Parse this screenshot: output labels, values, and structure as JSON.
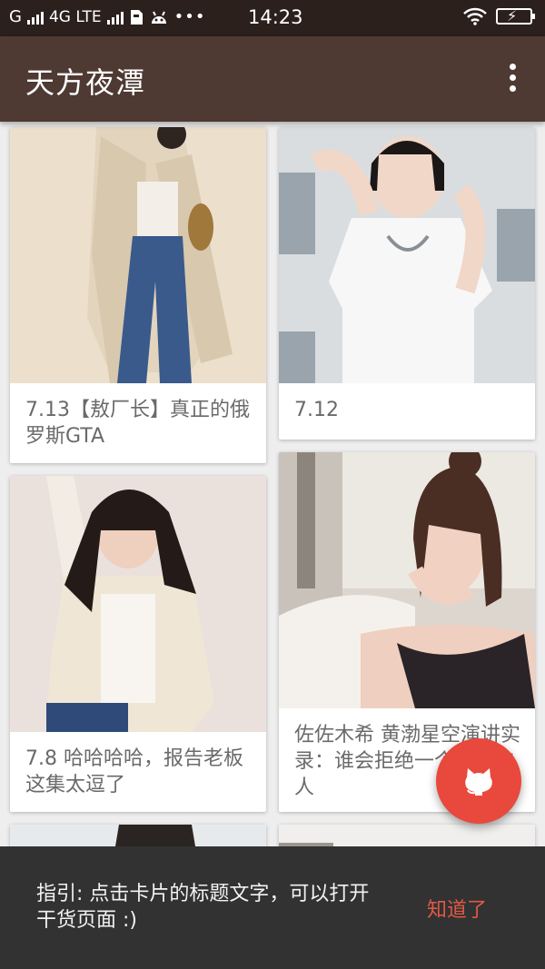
{
  "status_bar": {
    "carrier_left": "G",
    "network": "4G LTE",
    "time": "14:23"
  },
  "app_bar": {
    "title": "天方夜潭",
    "menu_icon": "more-vert-icon"
  },
  "cards": [
    {
      "caption": "7.13【敖厂长】真正的俄罗斯GTA",
      "image": "photo-woman-trench-coat"
    },
    {
      "caption": "7.12",
      "image": "photo-woman-white-blouse"
    },
    {
      "caption": "7.8 哈哈哈哈，报告老板这集太逗了",
      "image": "photo-woman-long-hair-jacket"
    },
    {
      "caption": "佐佐木希 黄渤星空演讲实录：谁会拒绝一个幽默的人",
      "image": "photo-woman-window-pose"
    }
  ],
  "fab": {
    "icon": "github-octocat-icon"
  },
  "snackbar": {
    "message": "指引: 点击卡片的标题文字，可以打开干货页面 :)",
    "action": "知道了",
    "action_color": "#e25845"
  },
  "colors": {
    "appbar": "#4e3a33",
    "statusbar": "#2b201c",
    "fab": "#e8493c",
    "snackbar": "#323232"
  }
}
